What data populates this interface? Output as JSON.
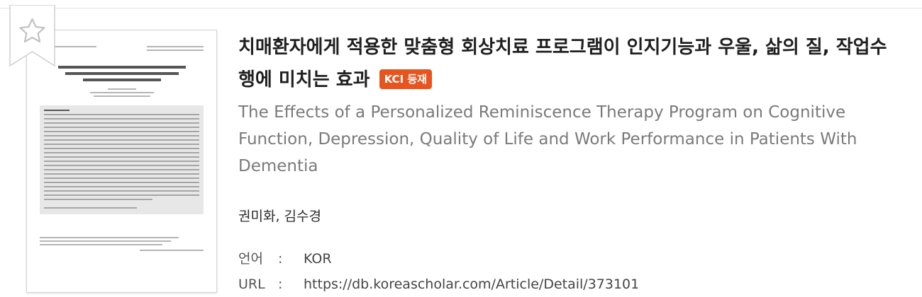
{
  "item": {
    "title": "치매환자에게 적용한 맞춤형 회상치료 프로그램이 인지기능과 우울, 삶의 질, 작업수행에 미치는 효과",
    "badge": "KCI 등재",
    "subtitle": "The Effects of a Personalized Reminiscence Therapy Program on Cognitive Function, Depression, Quality of Life and Work Performance in Patients With Dementia",
    "authors": "권미화, 김수경",
    "meta": [
      {
        "key": "언어",
        "sep": ":",
        "value": "KOR"
      },
      {
        "key": "URL",
        "sep": ":",
        "value": "https://db.koreascholar.com/Article/Detail/373101"
      }
    ]
  },
  "icons": {
    "bookmark": "star-bookmark-icon"
  },
  "colors": {
    "badge": "#e8541e",
    "subtitle": "#7a7a7a",
    "title": "#1f1f1f"
  }
}
